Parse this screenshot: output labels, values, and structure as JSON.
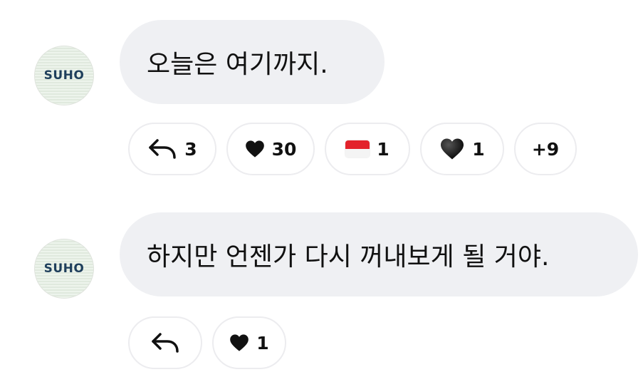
{
  "messages": [
    {
      "avatar_text": "SUHO",
      "text": "오늘은 여기까지.",
      "reactions": [
        {
          "icon": "reply-arrow-icon",
          "count": "3"
        },
        {
          "icon": "heart-icon",
          "count": "30"
        },
        {
          "icon": "indonesia-flag-icon",
          "count": "1"
        },
        {
          "icon": "black-heart-emoji-icon",
          "count": "1"
        },
        {
          "label": "+9"
        }
      ]
    },
    {
      "avatar_text": "SUHO",
      "text": "하지만 언젠가 다시 꺼내보게 될 거야.",
      "reactions": [
        {
          "icon": "reply-arrow-icon",
          "count": ""
        },
        {
          "icon": "heart-icon",
          "count": "1"
        }
      ]
    }
  ],
  "colors": {
    "bubble_bg": "#eff0f3",
    "pill_border": "#ececef",
    "avatar_text": "#1f3f5c",
    "flag_red": "#e3222b"
  }
}
